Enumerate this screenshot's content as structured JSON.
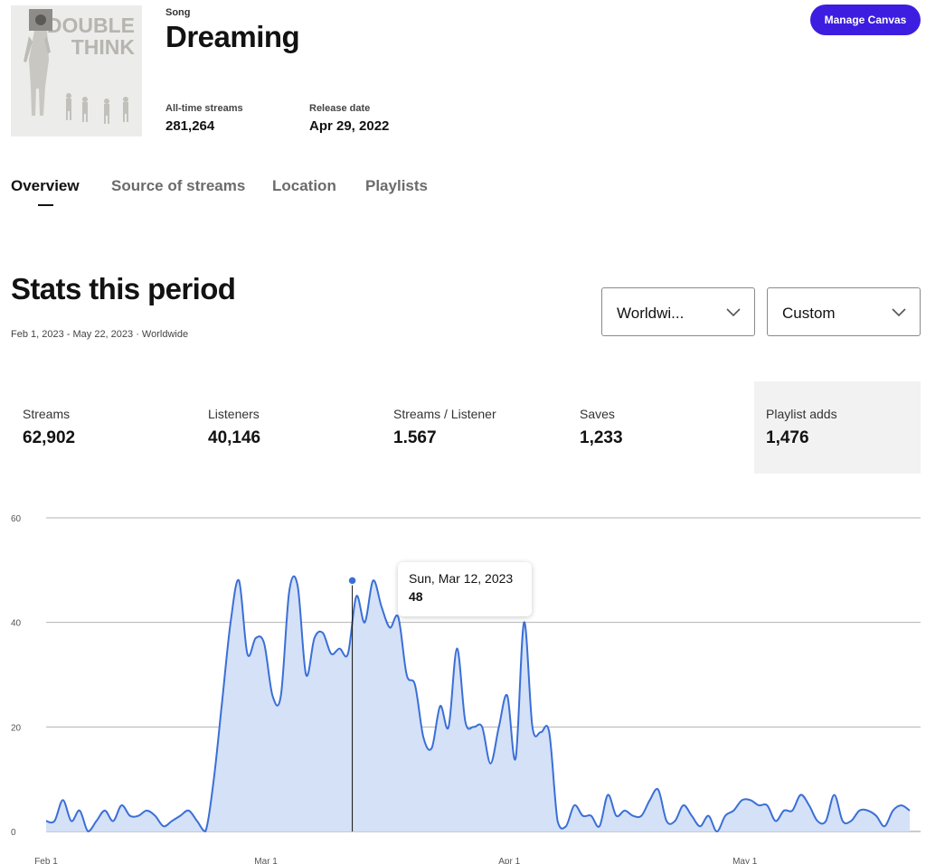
{
  "header": {
    "type_label": "Song",
    "title": "Dreaming",
    "cover_text_line1": "DOUBLE",
    "cover_text_line2": "THINK",
    "all_time_streams_label": "All-time streams",
    "all_time_streams_value": "281,264",
    "release_date_label": "Release date",
    "release_date_value": "Apr 29, 2022",
    "manage_canvas_label": "Manage Canvas",
    "accent_color": "#3d1ee0"
  },
  "tabs": [
    {
      "label": "Overview",
      "active": true
    },
    {
      "label": "Source of streams",
      "active": false
    },
    {
      "label": "Location",
      "active": false
    },
    {
      "label": "Playlists",
      "active": false
    }
  ],
  "stats": {
    "title": "Stats this period",
    "subtitle": "Feb 1, 2023 - May 22, 2023 · Worldwide",
    "location_dropdown": {
      "value": "Worldwi...",
      "icon": "chevron-down-icon"
    },
    "period_dropdown": {
      "value": "Custom",
      "icon": "chevron-down-icon"
    }
  },
  "metrics": [
    {
      "label": "Streams",
      "value": "62,902",
      "selected": false
    },
    {
      "label": "Listeners",
      "value": "40,146",
      "selected": false
    },
    {
      "label": "Streams / Listener",
      "value": "1.567",
      "selected": false
    },
    {
      "label": "Saves",
      "value": "1,233",
      "selected": false
    },
    {
      "label": "Playlist adds",
      "value": "1,476",
      "selected": true
    }
  ],
  "tooltip": {
    "date": "Sun, Mar 12, 2023",
    "value": "48"
  },
  "chart_data": {
    "type": "area",
    "x_start": "2023-02-01",
    "x_end": "2023-05-22",
    "xticks": [
      "Feb 1",
      "Mar 1",
      "Apr 1",
      "May 1"
    ],
    "yticks": [
      "0",
      "20",
      "40",
      "60"
    ],
    "ylim": [
      0,
      60
    ],
    "grid": true,
    "line_color": "#3b6fd6",
    "fill_color": "#d4e1f7",
    "highlight": {
      "date": "2023-03-12",
      "value": 48
    },
    "values": [
      2,
      2,
      6,
      2,
      4,
      0,
      2,
      4,
      2,
      5,
      3,
      3,
      4,
      3,
      1,
      2,
      3,
      4,
      2,
      0,
      10,
      25,
      40,
      48,
      34,
      37,
      36,
      26,
      26,
      46,
      47,
      30,
      37,
      38,
      34,
      35,
      34,
      45,
      40,
      48,
      43,
      39,
      41,
      30,
      28,
      18,
      16,
      24,
      20,
      35,
      21,
      20,
      20,
      13,
      20,
      26,
      14,
      40,
      20,
      19,
      19,
      2,
      1,
      5,
      3,
      3,
      1,
      7,
      3,
      4,
      3,
      3,
      6,
      8,
      2,
      2,
      5,
      3,
      1,
      3,
      0,
      3,
      4,
      6,
      6,
      5,
      5,
      2,
      4,
      4,
      7,
      5,
      2,
      2,
      7,
      2,
      2,
      4,
      4,
      3,
      1,
      4,
      5,
      4
    ]
  }
}
